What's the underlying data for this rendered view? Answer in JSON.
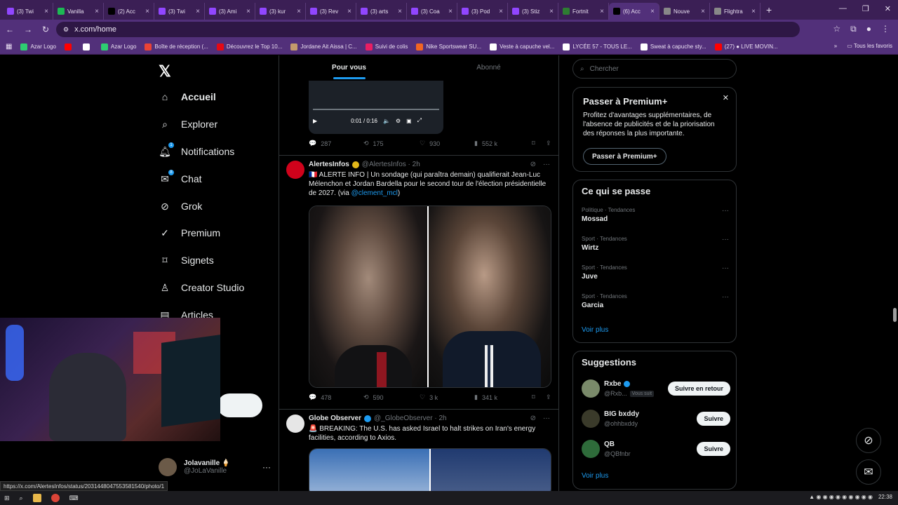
{
  "browser": {
    "tabs": [
      {
        "label": "(3) Twi",
        "color": "#9146ff",
        "active": false
      },
      {
        "label": "Vanilla",
        "color": "#1db954",
        "active": false
      },
      {
        "label": "(2) Acc",
        "color": "#000000",
        "active": false
      },
      {
        "label": "(3) Twi",
        "color": "#9146ff",
        "active": false
      },
      {
        "label": "(3) Ami",
        "color": "#9146ff",
        "active": false
      },
      {
        "label": "(3) kur",
        "color": "#9146ff",
        "active": false
      },
      {
        "label": "(3) Rev",
        "color": "#9146ff",
        "active": false
      },
      {
        "label": "(3) arts",
        "color": "#9146ff",
        "active": false
      },
      {
        "label": "(3) Coa",
        "color": "#9146ff",
        "active": false
      },
      {
        "label": "(3) Pod",
        "color": "#9146ff",
        "active": false
      },
      {
        "label": "(3) Stiz",
        "color": "#9146ff",
        "active": false
      },
      {
        "label": "Fortnit",
        "color": "#2e7d32",
        "active": false
      },
      {
        "label": "(6) Acc",
        "color": "#000000",
        "active": true
      },
      {
        "label": "Nouve",
        "color": "#888888",
        "active": false
      },
      {
        "label": "Flightra",
        "color": "#888888",
        "active": false
      }
    ],
    "url": "x.com/home",
    "bookmarks": [
      {
        "label": "Azar Logo",
        "color": "#2ecc71"
      },
      {
        "label": "",
        "color": "#ff0000"
      },
      {
        "label": "",
        "color": "#ffffff"
      },
      {
        "label": "Azar Logo",
        "color": "#2ecc71"
      },
      {
        "label": "Boîte de réception (...",
        "color": "#ea4335"
      },
      {
        "label": "Découvrez le Top 10...",
        "color": "#e50914"
      },
      {
        "label": "Jordane Ait Aissa | C...",
        "color": "#c49a6c"
      },
      {
        "label": "Suivi de colis",
        "color": "#e91e63"
      },
      {
        "label": "Nike Sportswear SU...",
        "color": "#f26522"
      },
      {
        "label": "Veste à capuche vel...",
        "color": "#ffffff"
      },
      {
        "label": "LYCÉE 57 - TOUS LE...",
        "color": "#ffffff"
      },
      {
        "label": "Sweat à capuche sty...",
        "color": "#ffffff"
      },
      {
        "label": "(27) ● LIVE MOVIN...",
        "color": "#ff0000"
      }
    ],
    "all_bookmarks": "Tous les favoris",
    "status_url": "https://x.com/AlertesInfos/status/2031448047553581540/photo/1"
  },
  "nav": {
    "items": [
      {
        "label": "Accueil",
        "icon": "home-icon",
        "bold": true,
        "badge": ""
      },
      {
        "label": "Explorer",
        "icon": "search-icon",
        "bold": false,
        "badge": ""
      },
      {
        "label": "Notifications",
        "icon": "bell-icon",
        "bold": false,
        "badge": "1"
      },
      {
        "label": "Chat",
        "icon": "mail-icon",
        "bold": false,
        "badge": "8"
      },
      {
        "label": "Grok",
        "icon": "grok-icon",
        "bold": false,
        "badge": ""
      },
      {
        "label": "Premium",
        "icon": "premium-icon",
        "bold": false,
        "badge": ""
      },
      {
        "label": "Signets",
        "icon": "bookmark-icon",
        "bold": false,
        "badge": ""
      },
      {
        "label": "Creator Studio",
        "icon": "creator-icon",
        "bold": false,
        "badge": ""
      },
      {
        "label": "Articles",
        "icon": "articles-icon",
        "bold": false,
        "badge": ""
      }
    ],
    "profile": {
      "name": "Jolavanille 🍦",
      "handle": "@JoLaVanille"
    }
  },
  "feed": {
    "tabs": [
      "Pour vous",
      "Abonné"
    ],
    "video": {
      "time": "0:01 / 0:16"
    },
    "first_actions": {
      "replies": "287",
      "reposts": "175",
      "likes": "930",
      "views": "552 k"
    },
    "tweets": [
      {
        "name": "AlertesInfos",
        "handle": "@AlertesInfos · 2h",
        "text": "🇫🇷 ALERTE INFO | Un sondage (qui paraîtra demain) qualifierait Jean-Luc Mélenchon et Jordan Bardella pour le second tour de l'élection présidentielle de 2027. (via ",
        "link": "@clement_mcl",
        "text_end": ")",
        "actions": {
          "replies": "478",
          "reposts": "590",
          "likes": "3 k",
          "views": "341 k"
        }
      },
      {
        "name": "Globe Observer",
        "handle": "@_GlobeObserver · 2h",
        "text": "🚨 BREAKING: The U.S. has asked Israel to halt strikes on Iran's energy facilities, according to Axios.",
        "link": "",
        "text_end": ""
      }
    ]
  },
  "sidebar": {
    "search_placeholder": "Chercher",
    "premium": {
      "title": "Passer à Premium+",
      "desc": "Profitez d'avantages supplémentaires, de l'absence de publicités et de la priorisation des réponses la plus importante.",
      "button": "Passer à Premium+"
    },
    "trends": {
      "title": "Ce qui se passe",
      "items": [
        {
          "category": "Politique · Tendances",
          "name": "Mossad"
        },
        {
          "category": "Sport · Tendances",
          "name": "Wirtz"
        },
        {
          "category": "Sport · Tendances",
          "name": "Juve"
        },
        {
          "category": "Sport · Tendances",
          "name": "Garcia"
        }
      ],
      "more": "Voir plus"
    },
    "suggestions": {
      "title": "Suggestions",
      "items": [
        {
          "name": "Rxbe",
          "handle": "@Rxb...",
          "tag": "Vous suit",
          "button": "Suivre en retour",
          "color": "#7a8a6a"
        },
        {
          "name": "BIG bxddy",
          "handle": "@ohhbxddy",
          "tag": "",
          "button": "Suivre",
          "color": "#3a3a2a"
        },
        {
          "name": "QB",
          "handle": "@QBfnbr",
          "tag": "",
          "button": "Suivre",
          "color": "#2e6b3a"
        }
      ],
      "more": "Voir plus"
    }
  },
  "taskbar": {
    "time": "22:38"
  }
}
